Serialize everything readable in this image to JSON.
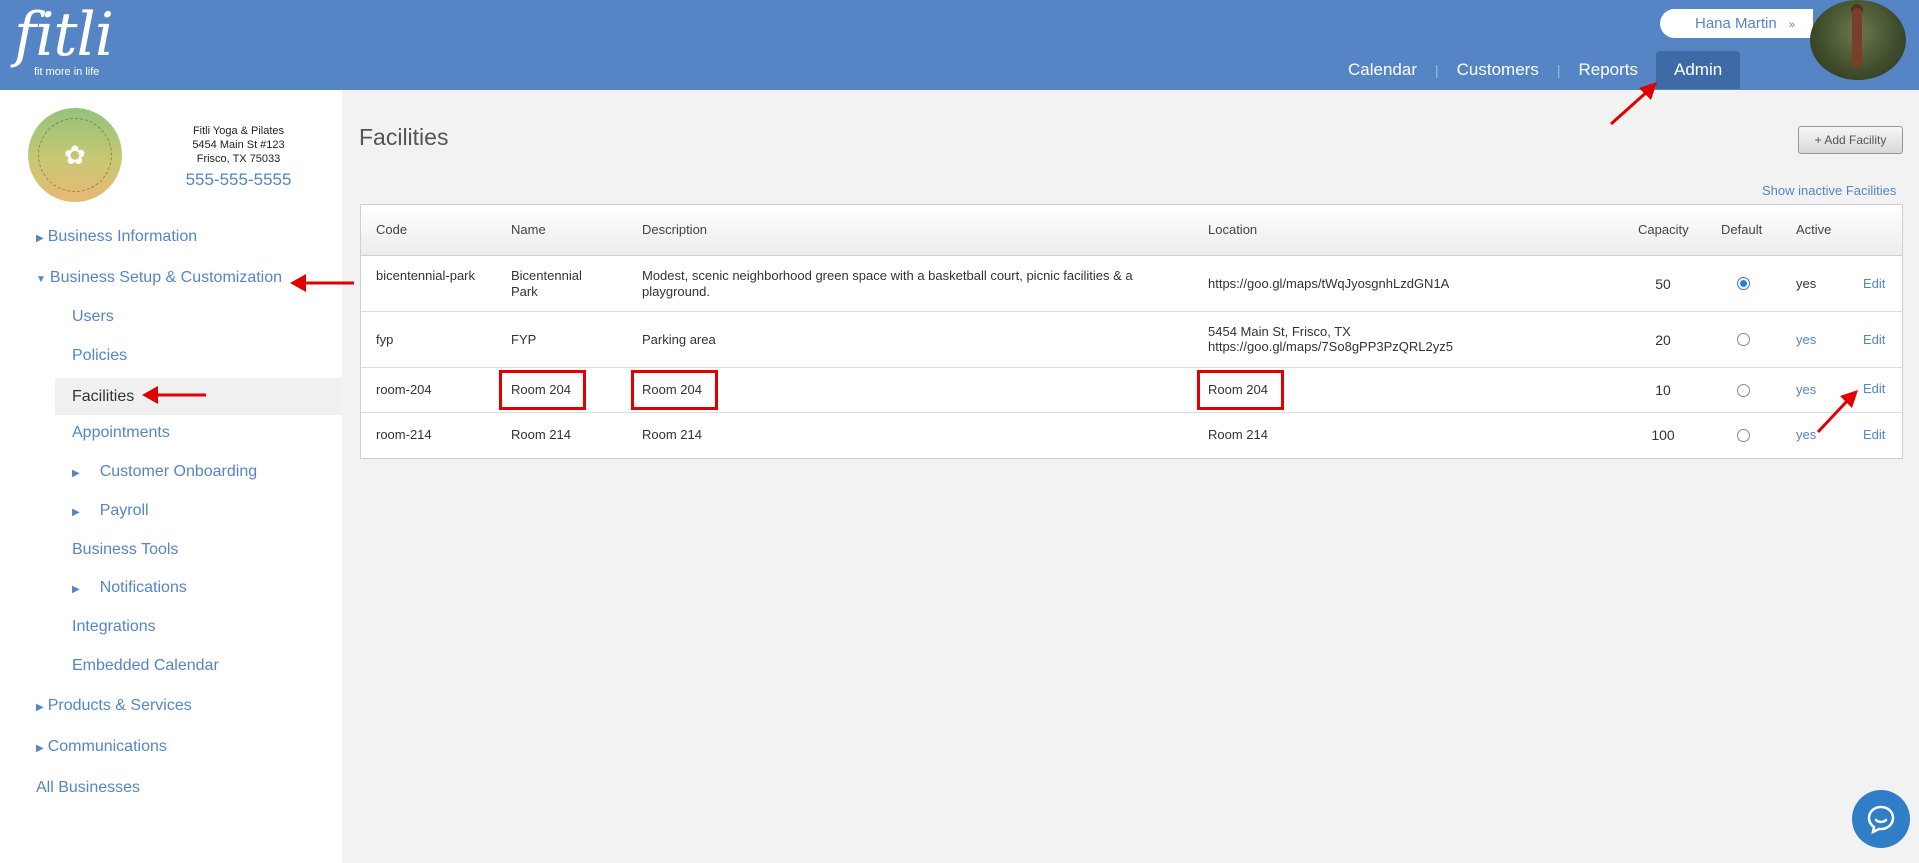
{
  "header": {
    "logo_word": "fitli",
    "logo_tagline": "fit more in life",
    "user_name": "Hana Martin",
    "user_chevron": "»",
    "nav": [
      {
        "label": "Calendar"
      },
      {
        "label": "Customers"
      },
      {
        "label": "Reports"
      },
      {
        "label": "Admin"
      }
    ],
    "nav_separator": "|"
  },
  "business": {
    "name": "Fitli Yoga & Pilates",
    "address1": "5454 Main St #123",
    "address2": "Frisco, TX 75033",
    "phone": "555-555-5555"
  },
  "sidebar": {
    "items": [
      {
        "label": "Business Information"
      },
      {
        "label": "Business Setup & Customization"
      },
      {
        "label": "Users"
      },
      {
        "label": "Policies"
      },
      {
        "label": "Facilities"
      },
      {
        "label": "Appointments"
      },
      {
        "label": "Customer Onboarding"
      },
      {
        "label": "Payroll"
      },
      {
        "label": "Business Tools"
      },
      {
        "label": "Notifications"
      },
      {
        "label": "Integrations"
      },
      {
        "label": "Embedded Calendar"
      },
      {
        "label": "Products & Services"
      },
      {
        "label": "Communications"
      },
      {
        "label": "All Businesses"
      }
    ]
  },
  "main": {
    "title": "Facilities",
    "add_button": "+ Add Facility",
    "show_inactive": "Show inactive Facilities",
    "columns": [
      "Code",
      "Name",
      "Description",
      "Location",
      "Capacity",
      "Default",
      "Active",
      ""
    ],
    "rows": [
      {
        "code": "bicentennial-park",
        "name": "Bicentennial Park",
        "description": "Modest, scenic neighborhood green space with a basketball court, picnic facilities & a playground.",
        "location1": "https://goo.gl/maps/tWqJyosgnhLzdGN1A",
        "location2": "",
        "capacity": "50",
        "default": true,
        "active": "yes",
        "action": "Edit"
      },
      {
        "code": "fyp",
        "name": "FYP",
        "description": "Parking area",
        "location1": "5454 Main St, Frisco, TX",
        "location2": "https://goo.gl/maps/7So8gPP3PzQRL2yz5",
        "capacity": "20",
        "default": false,
        "active": "yes",
        "action": "Edit"
      },
      {
        "code": "room-204",
        "name": "Room 204",
        "description": "Room 204",
        "location1": "Room 204",
        "location2": "",
        "capacity": "10",
        "default": false,
        "active": "yes",
        "action": "Edit"
      },
      {
        "code": "room-214",
        "name": "Room 214",
        "description": "Room 214",
        "location1": "Room 214",
        "location2": "",
        "capacity": "100",
        "default": false,
        "active": "yes",
        "action": "Edit"
      }
    ]
  },
  "colors": {
    "brand": "#5585c5",
    "nav_active": "#3e6aa6",
    "annotation": "#e00000",
    "radio_selected": "#2a7ae2"
  },
  "icons": [
    "caret-right-icon",
    "caret-down-icon",
    "chevron-down-icon",
    "chat-icon",
    "annotation-arrow-icon"
  ]
}
